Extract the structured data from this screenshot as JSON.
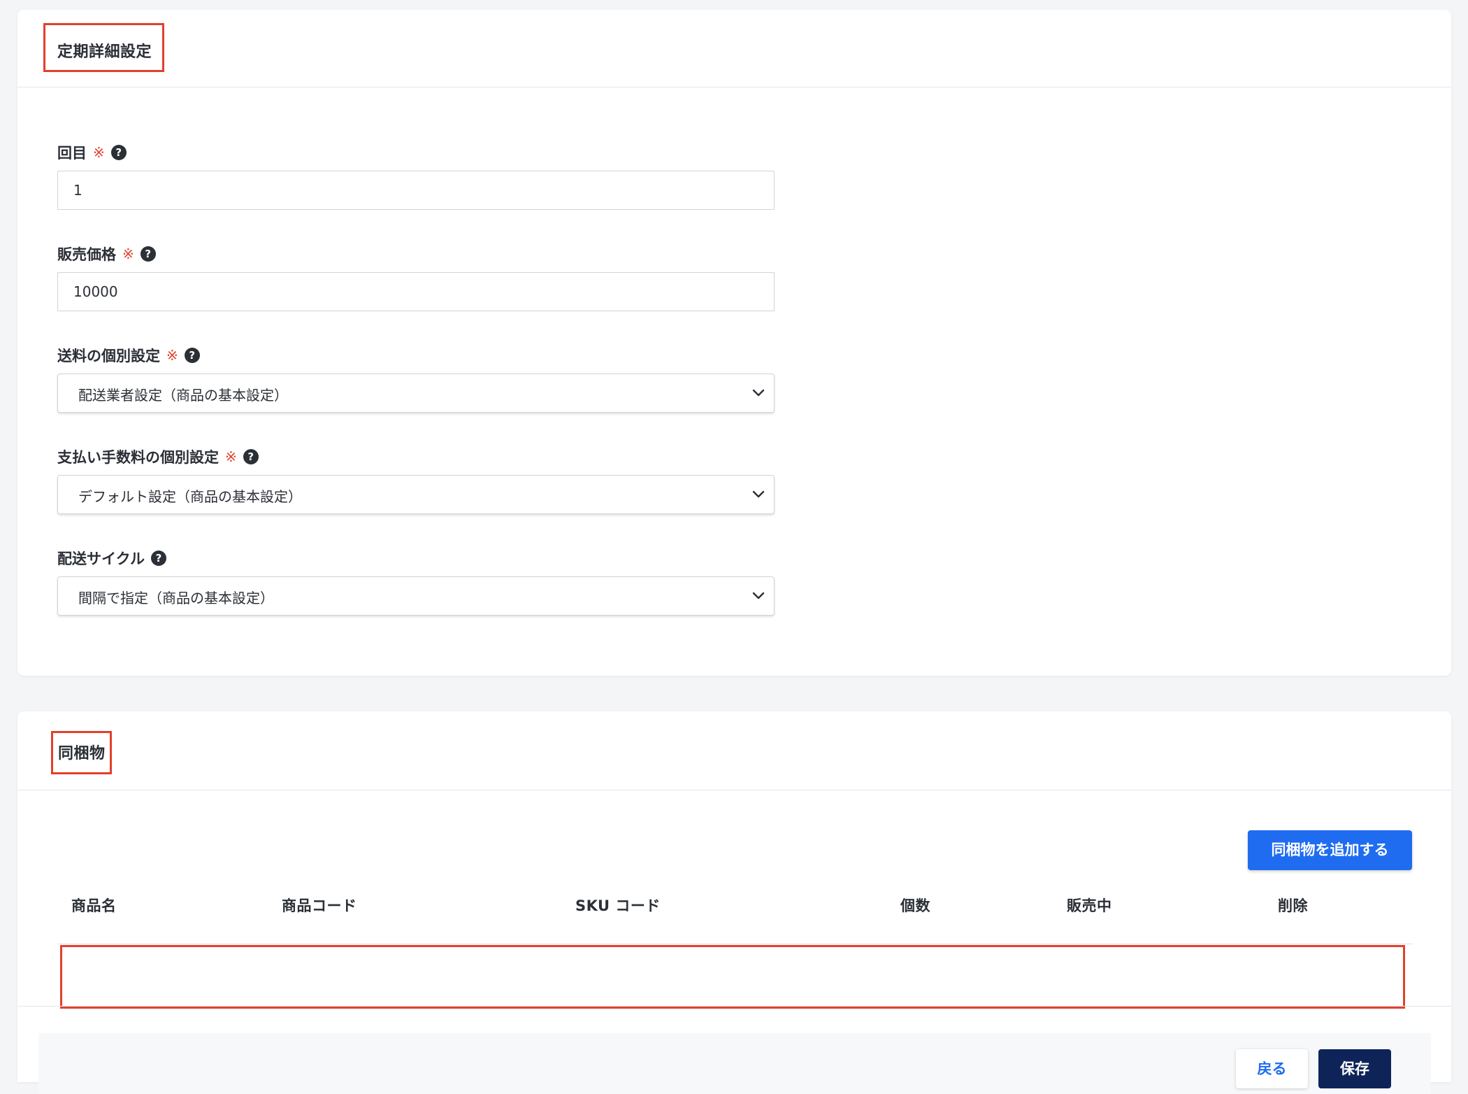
{
  "settings_card": {
    "title": "定期詳細設定",
    "fields": {
      "round": {
        "label": "回目",
        "required_mark": "※",
        "help_icon": "question-circle-icon",
        "value": "1"
      },
      "price": {
        "label": "販売価格",
        "required_mark": "※",
        "help_icon": "question-circle-icon",
        "value": "10000"
      },
      "shipping_fee": {
        "label": "送料の個別設定",
        "required_mark": "※",
        "help_icon": "question-circle-icon",
        "selected": "配送業者設定（商品の基本設定）"
      },
      "payment_fee": {
        "label": "支払い手数料の個別設定",
        "required_mark": "※",
        "help_icon": "question-circle-icon",
        "selected": "デフォルト設定（商品の基本設定）"
      },
      "delivery_cycle": {
        "label": "配送サイクル",
        "help_icon": "question-circle-icon",
        "selected": "間隔で指定（商品の基本設定）"
      }
    }
  },
  "bundle_card": {
    "title": "同梱物",
    "add_button": "同梱物を追加する",
    "table": {
      "columns": [
        "商品名",
        "商品コード",
        "SKU コード",
        "個数",
        "販売中",
        "削除"
      ],
      "rows": []
    }
  },
  "footer": {
    "back_button": "戻る",
    "save_button": "保存"
  },
  "colors": {
    "primary": "#1f6cf0",
    "dark_primary": "#0e2458",
    "required": "#e2402b",
    "highlight": "#e2402b"
  }
}
